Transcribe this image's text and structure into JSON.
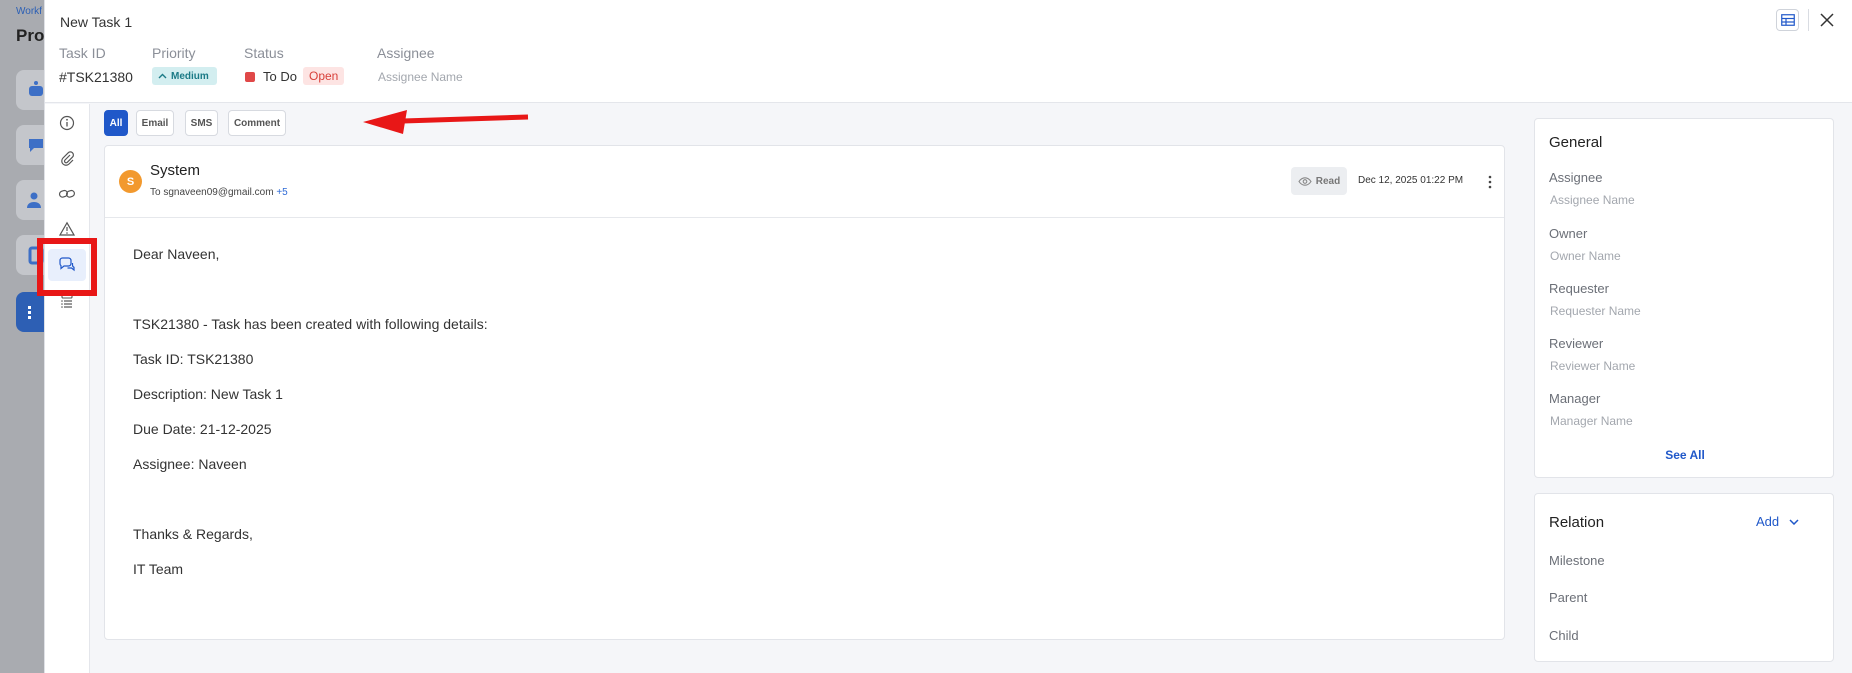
{
  "background_app": {
    "breadcrumb": "Workf",
    "title": "Proj"
  },
  "header": {
    "task_title": "New Task 1",
    "task_id_label": "Task ID",
    "task_id_value": "#TSK21380",
    "priority_label": "Priority",
    "priority_value": "Medium",
    "status_label": "Status",
    "status_value": "To Do",
    "status_badge": "Open",
    "assignee_label": "Assignee",
    "assignee_placeholder": "Assignee Name"
  },
  "rail": {
    "items": [
      "info-icon",
      "paperclip-icon",
      "link-icon",
      "warning-icon",
      "chat-icon",
      "list-icon"
    ],
    "active": "chat-icon"
  },
  "tabs": [
    {
      "label": "All",
      "active": true
    },
    {
      "label": "Email",
      "active": false
    },
    {
      "label": "SMS",
      "active": false
    },
    {
      "label": "Comment",
      "active": false
    }
  ],
  "message": {
    "avatar_letter": "S",
    "sender": "System",
    "to_prefix": "To",
    "to_email": "sgnaveen09@gmail.com",
    "more_recipients": "+5",
    "read_label": "Read",
    "date": "Dec 12, 2025 01:22 PM",
    "body_lines": [
      "Dear Naveen,",
      "",
      "TSK21380 - Task has been created with following details:",
      "Task ID: TSK21380",
      "Description: New Task 1",
      "Due Date: 21-12-2025",
      "Assignee: Naveen",
      "",
      "Thanks & Regards,",
      "IT Team"
    ]
  },
  "general": {
    "title": "General",
    "fields": [
      {
        "label": "Assignee",
        "placeholder": "Assignee Name"
      },
      {
        "label": "Owner",
        "placeholder": "Owner Name"
      },
      {
        "label": "Requester",
        "placeholder": "Requester Name"
      },
      {
        "label": "Reviewer",
        "placeholder": "Reviewer Name"
      },
      {
        "label": "Manager",
        "placeholder": "Manager Name"
      }
    ],
    "see_all": "See All"
  },
  "relation": {
    "title": "Relation",
    "add_label": "Add",
    "fields": [
      "Milestone",
      "Parent",
      "Child"
    ]
  },
  "colors": {
    "accent": "#2058c9",
    "priority_bg": "#d3eef0",
    "status_red": "#e04848",
    "avatar": "#f2992e",
    "annotation_red": "#e81717"
  }
}
